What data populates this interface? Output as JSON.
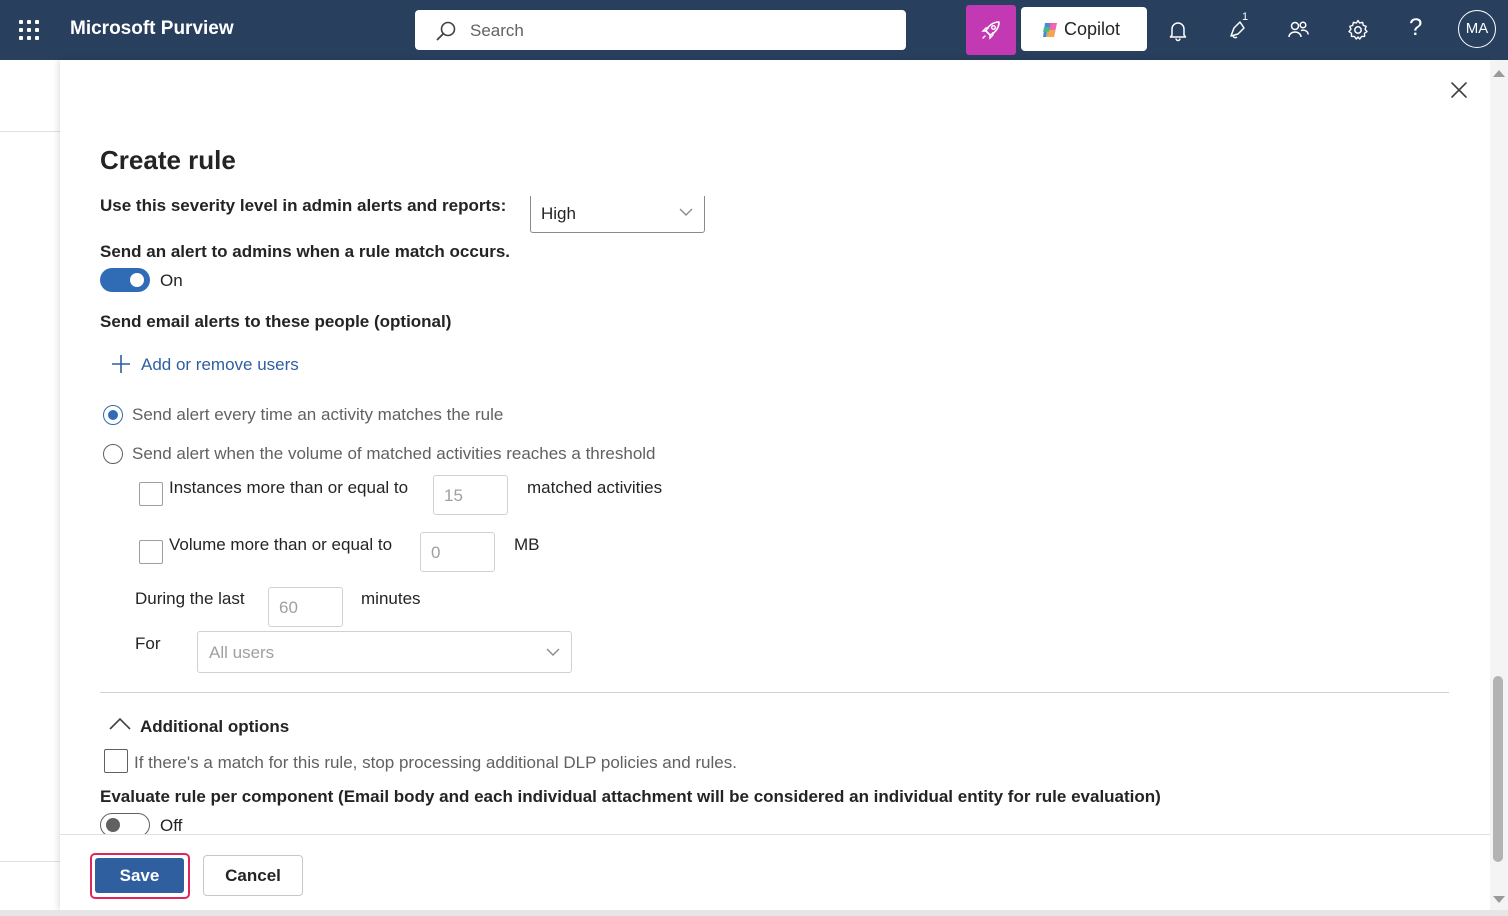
{
  "header": {
    "app_title": "Microsoft Purview",
    "search_placeholder": "Search",
    "copilot_label": "Copilot",
    "notification_count": "1",
    "help_glyph": "?",
    "avatar_initials": "MA",
    "icons": [
      "app-launcher-icon",
      "search-icon",
      "rocket-icon",
      "copilot-logo-icon",
      "bell-icon",
      "notification-icon",
      "people-icon",
      "gear-icon",
      "help-icon"
    ],
    "colors": {
      "bar": "#283f5e",
      "rocket_button": "#c239b3"
    }
  },
  "panel": {
    "title": "Create rule",
    "severity": {
      "label": "Use this severity level in admin alerts and reports:",
      "value": "High"
    },
    "admin_alert": {
      "label": "Send an alert to admins when a rule match occurs.",
      "toggle_state": "On",
      "on": true
    },
    "email_alerts": {
      "label": "Send email alerts to these people (optional)",
      "add_link": "Add or remove users"
    },
    "alert_frequency": {
      "option_every_time": "Send alert every time an activity matches the rule",
      "option_threshold": "Send alert when the volume of matched activities reaches a threshold",
      "selected": "every_time"
    },
    "threshold": {
      "instances_label": "Instances more than or equal to",
      "instances_value": "15",
      "instances_suffix": "matched activities",
      "volume_label": "Volume more than or equal to",
      "volume_value": "0",
      "volume_suffix": "MB",
      "during_label": "During the last",
      "during_value": "60",
      "during_suffix": "minutes",
      "for_label": "For",
      "for_value": "All users"
    },
    "additional_options": {
      "heading": "Additional options",
      "stop_processing": "If there's a match for this rule, stop processing additional DLP policies and rules.",
      "evaluate_label": "Evaluate rule per component (Email body and each individual attachment will be considered an individual entity for rule evaluation)",
      "evaluate_state": "Off",
      "evaluate_on": false
    }
  },
  "footer": {
    "save_label": "Save",
    "cancel_label": "Cancel",
    "accent": "#2f5f9e",
    "highlight": "#e0265a"
  }
}
